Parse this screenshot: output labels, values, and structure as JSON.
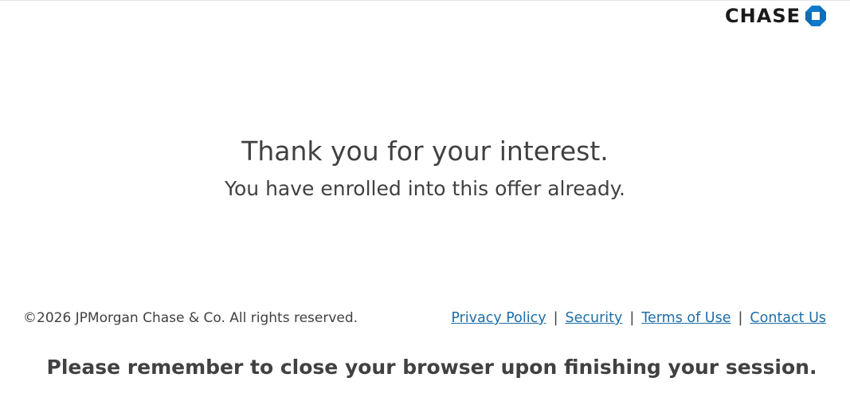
{
  "header": {
    "logo_text": "CHASE",
    "logo_icon": "chase-octagon-logo",
    "logo_color": "#117aca"
  },
  "main": {
    "headline": "Thank you for your interest.",
    "subline": "You have enrolled into this offer already."
  },
  "footer": {
    "copyright": "©2026 JPMorgan Chase & Co. All rights reserved.",
    "links": [
      {
        "label": "Privacy Policy"
      },
      {
        "label": "Security"
      },
      {
        "label": "Terms of Use"
      },
      {
        "label": "Contact Us"
      }
    ],
    "separator": "|",
    "link_color": "#1f6ea8"
  },
  "reminder": "Please remember to close your browser upon finishing your session."
}
